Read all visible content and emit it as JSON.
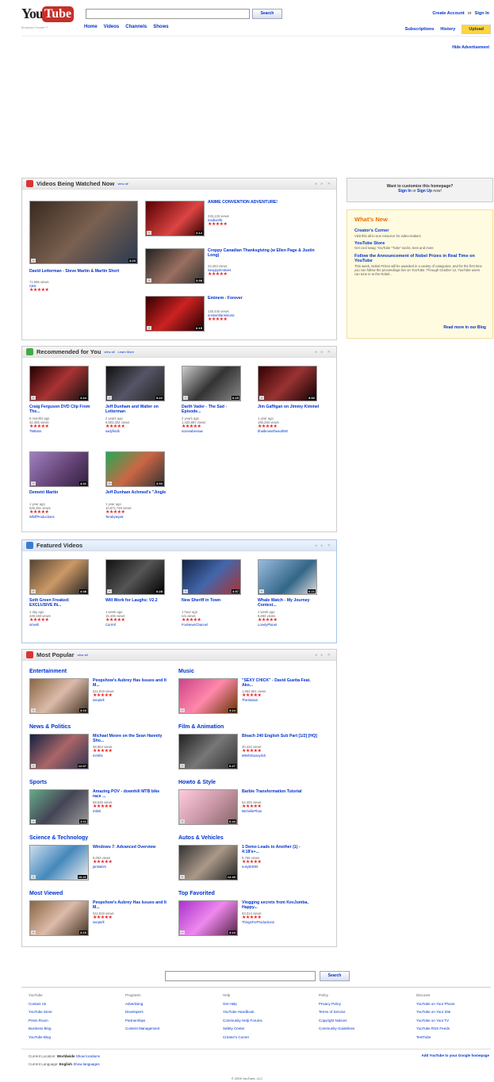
{
  "header": {
    "logo_you": "You",
    "logo_tube": "Tube",
    "tagline": "Broadcast Yourself ™",
    "search_button": "Search",
    "nav": [
      "Home",
      "Videos",
      "Channels",
      "Shows"
    ],
    "create_account": "Create Account",
    "or": "or",
    "sign_in": "Sign In",
    "subscriptions": "Subscriptions",
    "history": "History",
    "upload": "Upload",
    "hide_ad": "Hide Advertisement"
  },
  "watched_now": {
    "title": "Videos Being Watched Now",
    "view_all": "view all",
    "featured": {
      "title": "David Letterman - Steve Martin & Martin Short",
      "views": "71,595 views",
      "user": "CBS",
      "duration": "4:23"
    },
    "items": [
      {
        "title": "ANIME CONVENTION ADVENTURE!",
        "views": "225,133 views",
        "user": "mediumfit",
        "duration": "2:12"
      },
      {
        "title": "Croppy Canadian Thanksgiving (w Ellen Page & Justin Long)",
        "views": "23,263 views",
        "user": "Sexppyrimitives",
        "duration": "3:38"
      },
      {
        "title": "Eminem - Forever",
        "views": "145,440 views",
        "user": "eminemfansmusic",
        "duration": "6:19"
      }
    ]
  },
  "recommended": {
    "title": "Recommended for You",
    "view_all": "view all",
    "learn_more": "Learn More",
    "items": [
      {
        "title": "Craig Ferguson DVD Clip From The...",
        "age": "6 months ago",
        "views": "32,455 views",
        "user": "TMBoss",
        "duration": "2:24"
      },
      {
        "title": "Jeff Dunham and Walter on Letterman",
        "age": "2 years ago",
        "views": "9,803,402 views",
        "user": "sadyfindit",
        "duration": "5:22"
      },
      {
        "title": "Darth Vader - The Sad - Episode...",
        "age": "2 years ago",
        "views": "1,420,867 views",
        "user": "sozesabersaw",
        "duration": "6:25"
      },
      {
        "title": "Jim Gaffigan on Jimmy Kimmel",
        "age": "1 year ago",
        "views": "190,284 views",
        "user": "bhaibrowntheauth90",
        "duration": "5:52"
      },
      {
        "title": "Demetri Martin",
        "age": "1 year ago",
        "views": "525,361 views",
        "user": "WhiffProductions",
        "duration": "4:41"
      },
      {
        "title": "Jeff Dunham Achmed's \"Jingle",
        "age": "1 year ago",
        "views": "10,871,746 views",
        "user": "Terabyteyak",
        "duration": "3:53"
      }
    ]
  },
  "featured": {
    "title": "Featured Videos",
    "items": [
      {
        "title": "Seth Green Freaked: EXCLUSIVE IN...",
        "age": "1 day ago",
        "views": "349,183 views",
        "user": "smesh",
        "duration": "4:48"
      },
      {
        "title": "Will Work for Laughs: V2.2",
        "age": "1 week ago",
        "views": "15,435 views",
        "user": "Currrrrl",
        "duration": "6:28"
      },
      {
        "title": "New Sheriff in Town",
        "age": "1 hour ago",
        "views": "n/a views",
        "user": "FoxNewsChannel",
        "duration": "3:57"
      },
      {
        "title": "Whale Watch - My Journey Contest...",
        "age": "1 week ago",
        "views": "8,684 views",
        "user": "LonelyPlanet",
        "duration": "6:21"
      }
    ]
  },
  "most_popular": {
    "title": "Most Popular",
    "view_all": "view all",
    "categories": [
      {
        "name": "Entertainment",
        "title": "Peopshow's Aubrey Has Issues and It M...",
        "views": "511,919 views",
        "user": "seeptell",
        "duration": "3:23"
      },
      {
        "name": "Music",
        "title": "\"SEXY CHICK\" - David Guetta Feat. Ako...",
        "views": "1,954,961 views",
        "user": "TheStation",
        "duration": "3:24"
      },
      {
        "name": "News & Politics",
        "title": "Michael Moore on the Sean Hannity Sho...",
        "views": "38,853 views",
        "user": "mmfint",
        "duration": "12:07"
      },
      {
        "name": "Film & Animation",
        "title": "Bleach 240 English Sub Part [1/2] [HQ]",
        "views": "30,432 views",
        "user": "M9nhtGuseyitch",
        "duration": "6:27"
      },
      {
        "name": "Sports",
        "title": "Amazing POV - downhill MTB bike race ...",
        "views": "58,535 views",
        "user": "mtbsl",
        "duration": "3:11"
      },
      {
        "name": "Howto & Style",
        "title": "Barbie Transformation Tutorial",
        "views": "64,400 views",
        "user": "MichellePhan",
        "duration": "6:44"
      },
      {
        "name": "Science & Technology",
        "title": "Windows 7: Advanced Overview",
        "views": "8,053 views",
        "user": "janitators",
        "duration": "10:31"
      },
      {
        "name": "Autos & Vehicles",
        "title": "1 Demo Leads to Another (1) - 4:18's+...",
        "views": "9,756 views",
        "user": "eosybrik93",
        "duration": "12:43"
      },
      {
        "name": "Most Viewed",
        "title": "Peopshow's Aubrey Has Issues and It M...",
        "views": "511,919 views",
        "user": "seeptell",
        "duration": "3:23"
      },
      {
        "name": "Top Favorited",
        "title": "Vlogging secrets from KevJumba, Happy...",
        "views": "63,214 views",
        "user": "ThingsForProductions",
        "duration": "3:24"
      }
    ]
  },
  "sidebar": {
    "customize_title": "Want to customize this homepage?",
    "sign_in": "Sign In",
    "or": "or",
    "sign_up": "Sign Up",
    "now": "now!",
    "whats_new": "What's New",
    "items": [
      {
        "link": "Creator's Corner",
        "desc": "Visit this all-in-one resource for video-makers"
      },
      {
        "link": "YouTube Store",
        "desc": "Get cool swag: YouTube \"Tube\" socks, tees and more"
      },
      {
        "link": "Follow the Announcement of Nobel Prizes in Real Time on YouTube",
        "desc": "This week, Nobel Prizes will be awarded in a variety of categories, and for the first time you can follow the proceedings live on YouTube. Through October 12, YouTube users can tune in to the Nobel..."
      }
    ],
    "read_more": "Read more in our Blog"
  },
  "footer": {
    "search_button": "Search",
    "columns": [
      {
        "heading": "YouTube",
        "links": [
          "Contact Us",
          "YouTube Store",
          "Press Room",
          "Business Blog",
          "YouTube Blog"
        ]
      },
      {
        "heading": "Programs",
        "links": [
          "Advertising",
          "Developers",
          "Partnerships",
          "Content Management"
        ]
      },
      {
        "heading": "Help",
        "links": [
          "Get Help",
          "YouTube Handbook",
          "Community Help Forums",
          "Safety Center",
          "Creator's Corner"
        ]
      },
      {
        "heading": "Policy",
        "links": [
          "Privacy Policy",
          "Terms of Service",
          "Copyright Notices",
          "Community Guidelines"
        ]
      },
      {
        "heading": "Discover",
        "links": [
          "YouTube on Your Phone",
          "YouTube on Your Site",
          "YouTube on Your TV",
          "YouTube RSS Feeds",
          "TestTube"
        ]
      }
    ],
    "location_label": "Current Location:",
    "location": "Worldwide",
    "show_locations": "Show locations",
    "language_label": "Current Language:",
    "language": "English",
    "show_languages": "Show languages",
    "add_google": "Add YouTube to your Google homepage",
    "copyright": "© 2009 YouTube, LLC"
  },
  "colors": {
    "brand_red": "#c4302b",
    "link": "#0033cc",
    "upload": "#ffd540",
    "whats_new_bg": "#fffbe0",
    "stars": "#e22222"
  }
}
